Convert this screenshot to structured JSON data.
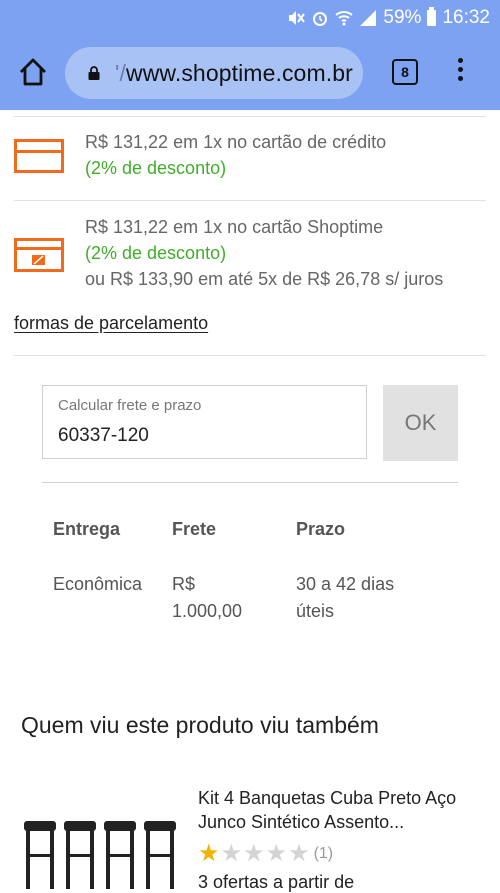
{
  "status_bar": {
    "battery": "59%",
    "time": "16:32",
    "icons": [
      "mute-icon",
      "alarm-icon",
      "wifi-icon",
      "signal-icon",
      "battery-icon"
    ]
  },
  "browser": {
    "url_prefix": "'/",
    "url": "www.shoptime.com.br",
    "tab_count": "8",
    "accent_color": "#7da2f2"
  },
  "payment": {
    "credit_card": {
      "line": "R$ 131,22 em 1x no cartão de crédito",
      "discount": "(2% de desconto)"
    },
    "store_card": {
      "line": "R$ 131,22 em 1x no cartão Shoptime",
      "discount": "(2% de desconto)",
      "installments": "ou R$ 133,90 em até 5x de R$ 26,78 s/ juros"
    },
    "installments_link": "formas de parcelamento",
    "icon_color": "#f26b1d",
    "discount_color": "#3fae29"
  },
  "shipping": {
    "input_label": "Calcular frete e prazo",
    "input_value": "60337-120",
    "ok_label": "OK",
    "headers": {
      "delivery": "Entrega",
      "freight": "Frete",
      "time": "Prazo"
    },
    "rows": [
      {
        "delivery": "Econômica",
        "freight_1": "R$",
        "freight_2": "1.000,00",
        "time_1": "30 a 42 dias",
        "time_2": "úteis"
      }
    ]
  },
  "related": {
    "title": "Quem viu este produto viu também",
    "products": [
      {
        "name": "Kit 4 Banquetas Cuba Preto Aço Junco Sintético Assento...",
        "rating_filled": 1,
        "rating_max": 5,
        "rating_count": "(1)",
        "offers": "3 ofertas a partir de"
      }
    ]
  }
}
